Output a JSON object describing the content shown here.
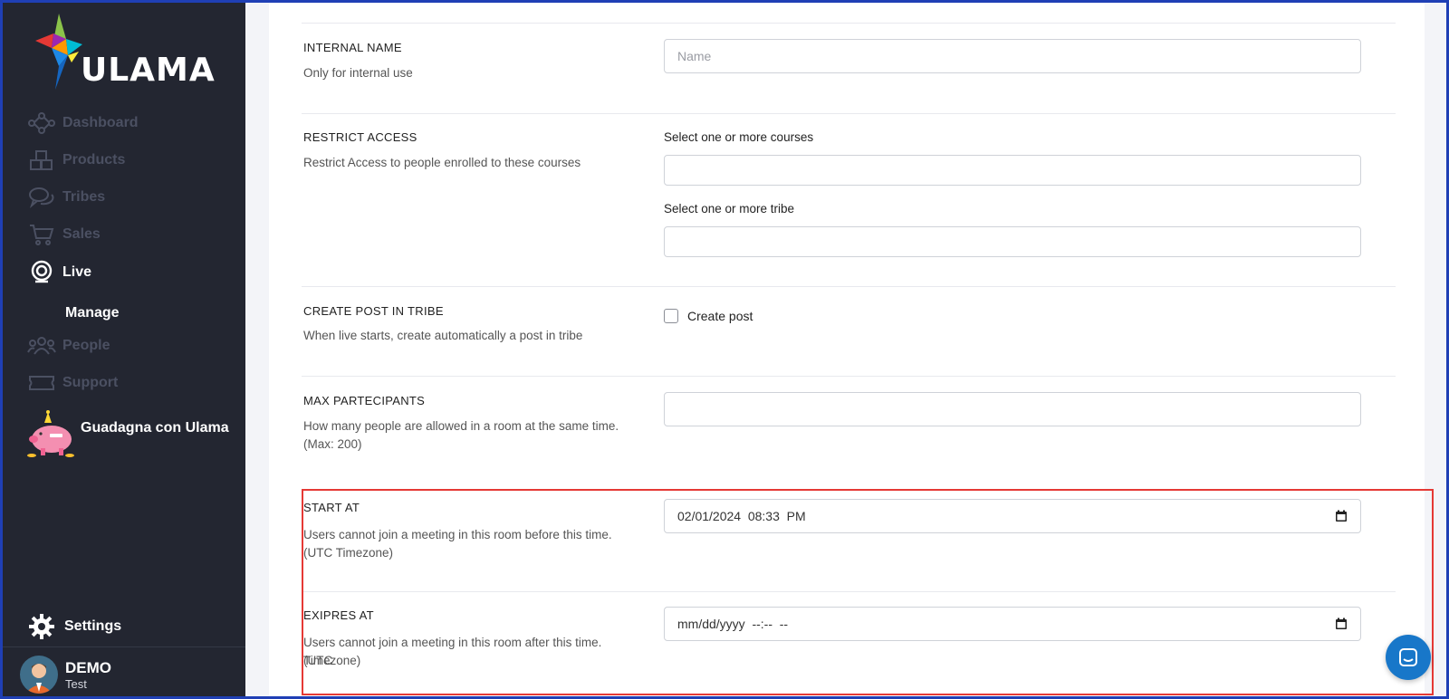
{
  "brand": {
    "name": "ULAMA"
  },
  "sidebar": {
    "items": [
      {
        "label": "Dashboard",
        "icon": "network-icon"
      },
      {
        "label": "Products",
        "icon": "boxes-icon"
      },
      {
        "label": "Tribes",
        "icon": "chat-bubbles-icon"
      },
      {
        "label": "Sales",
        "icon": "cart-icon"
      },
      {
        "label": "Live",
        "icon": "webcam-icon",
        "active": true
      },
      {
        "label": "People",
        "icon": "people-icon"
      },
      {
        "label": "Support",
        "icon": "ticket-icon"
      }
    ],
    "subitem": "Manage",
    "promo": "Guadagna con Ulama",
    "settings": "Settings",
    "user": {
      "name": "DEMO",
      "subtitle": "Test"
    }
  },
  "form": {
    "internal_name": {
      "label": "INTERNAL NAME",
      "desc": "Only for internal use",
      "placeholder": "Name"
    },
    "restrict_access": {
      "label": "RESTRICT ACCESS",
      "desc": "Restrict Access to people enrolled to these courses",
      "courses_label": "Select one or more courses",
      "tribe_label": "Select one or more tribe"
    },
    "create_post": {
      "label": "CREATE POST IN TRIBE",
      "desc": "When live starts, create automatically a post in tribe",
      "checkbox_label": "Create post",
      "checked": false
    },
    "max_participants": {
      "label": "MAX PARTECIPANTS",
      "desc_line1": "How many people are allowed in a room at the same time.",
      "desc_line2": "(Max: 200)"
    },
    "start_at": {
      "label": "START AT",
      "desc_line1": "Users cannot join a meeting in this room before this time.",
      "desc_line2": "(UTC Timezone)",
      "value": "02/01/2024  08:33  PM"
    },
    "expires_at": {
      "label": "EXIPRES AT",
      "desc_line1": "Users cannot join a meeting in this room after this time. (UTC",
      "desc_line2": "Timezone)",
      "value": "mm/dd/yyyy  --:--  --"
    }
  },
  "colors": {
    "sidebar_bg": "#232631",
    "highlight": "#e53935",
    "chat_button": "#1877c9",
    "frame": "#1f3fb5"
  }
}
